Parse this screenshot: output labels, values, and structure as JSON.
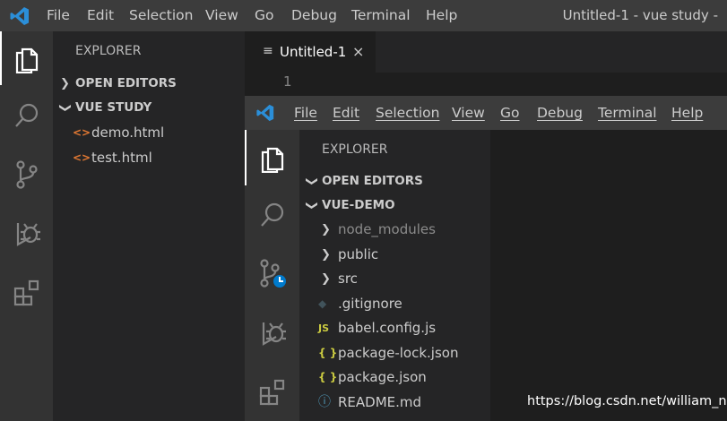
{
  "outer": {
    "menu": [
      "File",
      "Edit",
      "Selection",
      "View",
      "Go",
      "Debug",
      "Terminal",
      "Help"
    ],
    "window_title": "Untitled-1 - vue study -",
    "activity_icons": [
      "files-icon",
      "search-icon",
      "source-control-icon",
      "debug-icon",
      "extensions-icon"
    ],
    "sidebar": {
      "title": "EXPLORER",
      "open_editors": "OPEN EDITORS",
      "folder": "VUE STUDY",
      "files": [
        {
          "name": "demo.html",
          "icon": "<>"
        },
        {
          "name": "test.html",
          "icon": "<>"
        }
      ]
    },
    "tab": {
      "icon": "≡",
      "label": "Untitled-1",
      "close": "×"
    },
    "editor": {
      "line_number": "1"
    }
  },
  "inner": {
    "menu": [
      "File",
      "Edit",
      "Selection",
      "View",
      "Go",
      "Debug",
      "Terminal",
      "Help"
    ],
    "sidebar": {
      "title": "EXPLORER",
      "open_editors": "OPEN EDITORS",
      "folder": "VUE-DEMO",
      "items": [
        {
          "name": "node_modules",
          "kind": "folder",
          "dimmed": true
        },
        {
          "name": "public",
          "kind": "folder"
        },
        {
          "name": "src",
          "kind": "folder"
        },
        {
          "name": ".gitignore",
          "kind": "file",
          "icon": "◆",
          "color": "#41535b"
        },
        {
          "name": "babel.config.js",
          "kind": "file",
          "icon": "JS",
          "color": "#cbcb41"
        },
        {
          "name": "package-lock.json",
          "kind": "file",
          "icon": "{ }",
          "color": "#cbcb41"
        },
        {
          "name": "package.json",
          "kind": "file",
          "icon": "{ }",
          "color": "#cbcb41"
        },
        {
          "name": "README.md",
          "kind": "file",
          "icon": "ⓘ",
          "color": "#519aba"
        }
      ]
    }
  },
  "watermark": "https://blog.csdn.net/william_n",
  "colors": {
    "accent_blue": "#007acc",
    "titlebar": "#3c3c3c",
    "activity_bar": "#333333",
    "sidebar": "#252526",
    "editor": "#1e1e1e"
  }
}
